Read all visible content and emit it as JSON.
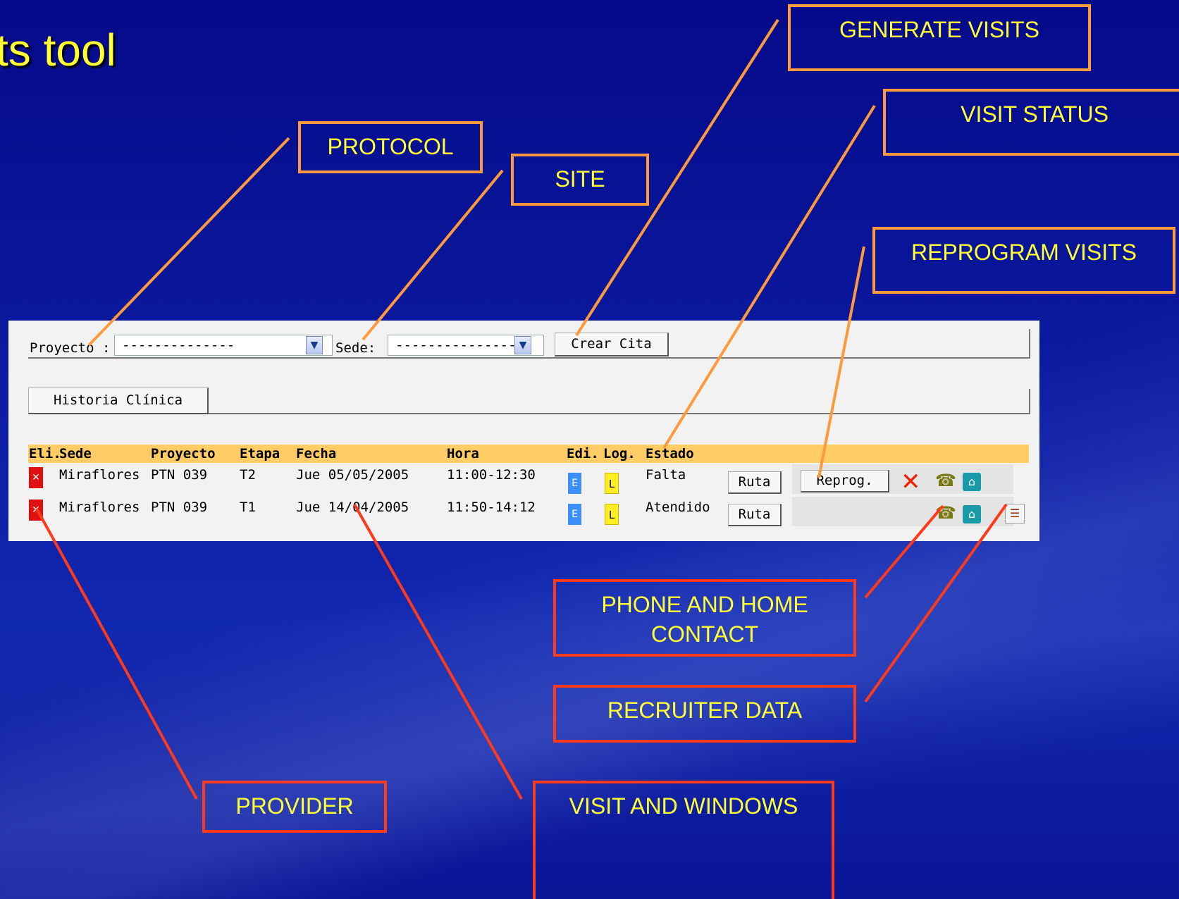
{
  "slide": {
    "title": "ts tool"
  },
  "callouts": {
    "protocol": "PROTOCOL",
    "site": "SITE",
    "generate_visits": "GENERATE VISITS",
    "visit_status": "VISIT STATUS",
    "reprogram_visits": "REPROGRAM VISITS",
    "phone_home_contact": "PHONE AND HOME CONTACT",
    "recruiter_data": "RECRUITER DATA",
    "provider": "PROVIDER",
    "visit_windows": "VISIT AND WINDOWS"
  },
  "filter_bar": {
    "proyecto_label": "Proyecto :",
    "proyecto_value": "--------------",
    "sede_label": "Sede:",
    "sede_value": "---------------",
    "crear_cita_label": "Crear Cita"
  },
  "history_bar": {
    "historia_label": "Historia Clínica"
  },
  "table": {
    "headers": {
      "eli": "Eli.",
      "sede": "Sede",
      "proyecto": "Proyecto",
      "etapa": "Etapa",
      "fecha": "Fecha",
      "hora": "Hora",
      "edi": "Edi.",
      "log": "Log.",
      "estado": "Estado"
    },
    "rows": [
      {
        "sede": "Miraflores",
        "proyecto": "PTN 039",
        "etapa": "T2",
        "fecha": "Jue 05/05/2005",
        "hora": "11:00-12:30",
        "edi": "E",
        "log": "L",
        "estado": "Falta",
        "ruta": "Ruta",
        "reprog": "Reprog."
      },
      {
        "sede": "Miraflores",
        "proyecto": "PTN 039",
        "etapa": "T1",
        "fecha": "Jue 14/04/2005",
        "hora": "11:50-14:12",
        "edi": "E",
        "log": "L",
        "estado": "Atendido",
        "ruta": "Ruta"
      }
    ]
  },
  "icons": {
    "delete": "delete-icon",
    "edit": "edit-icon",
    "log": "log-icon",
    "cancel": "close-icon",
    "phone": "phone-icon",
    "home": "home-icon",
    "recruiter": "recruiter-icon"
  },
  "colors": {
    "background": "#0b1a9e",
    "title_text": "#ffff33",
    "callout_border_orange": "#ff9a3c",
    "callout_border_red": "#ff3a1a",
    "table_header": "#ffcc66"
  }
}
